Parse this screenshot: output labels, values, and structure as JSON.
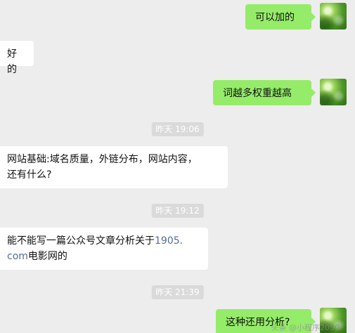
{
  "messages": [
    {
      "side": "out",
      "text": "可以加的"
    },
    {
      "side": "in",
      "text": "好的"
    },
    {
      "side": "out",
      "text": "词越多权重越高"
    },
    {
      "timestamp": "昨天 19:06"
    },
    {
      "side": "in",
      "line1": "网站基础:域名质量，外链分布，网站内容，",
      "line2": "还有什么?"
    },
    {
      "timestamp": "昨天 19:12"
    },
    {
      "side": "in",
      "line1_prefix": "能不能写一篇公众号文章分析关于",
      "link_a": "1905.",
      "link_b": "com",
      "line2_suffix": "电影网的"
    },
    {
      "timestamp": "昨天 21:39"
    },
    {
      "side": "out",
      "text": "这种还用分析?"
    }
  ],
  "watermark": "头条 @小程序2050"
}
